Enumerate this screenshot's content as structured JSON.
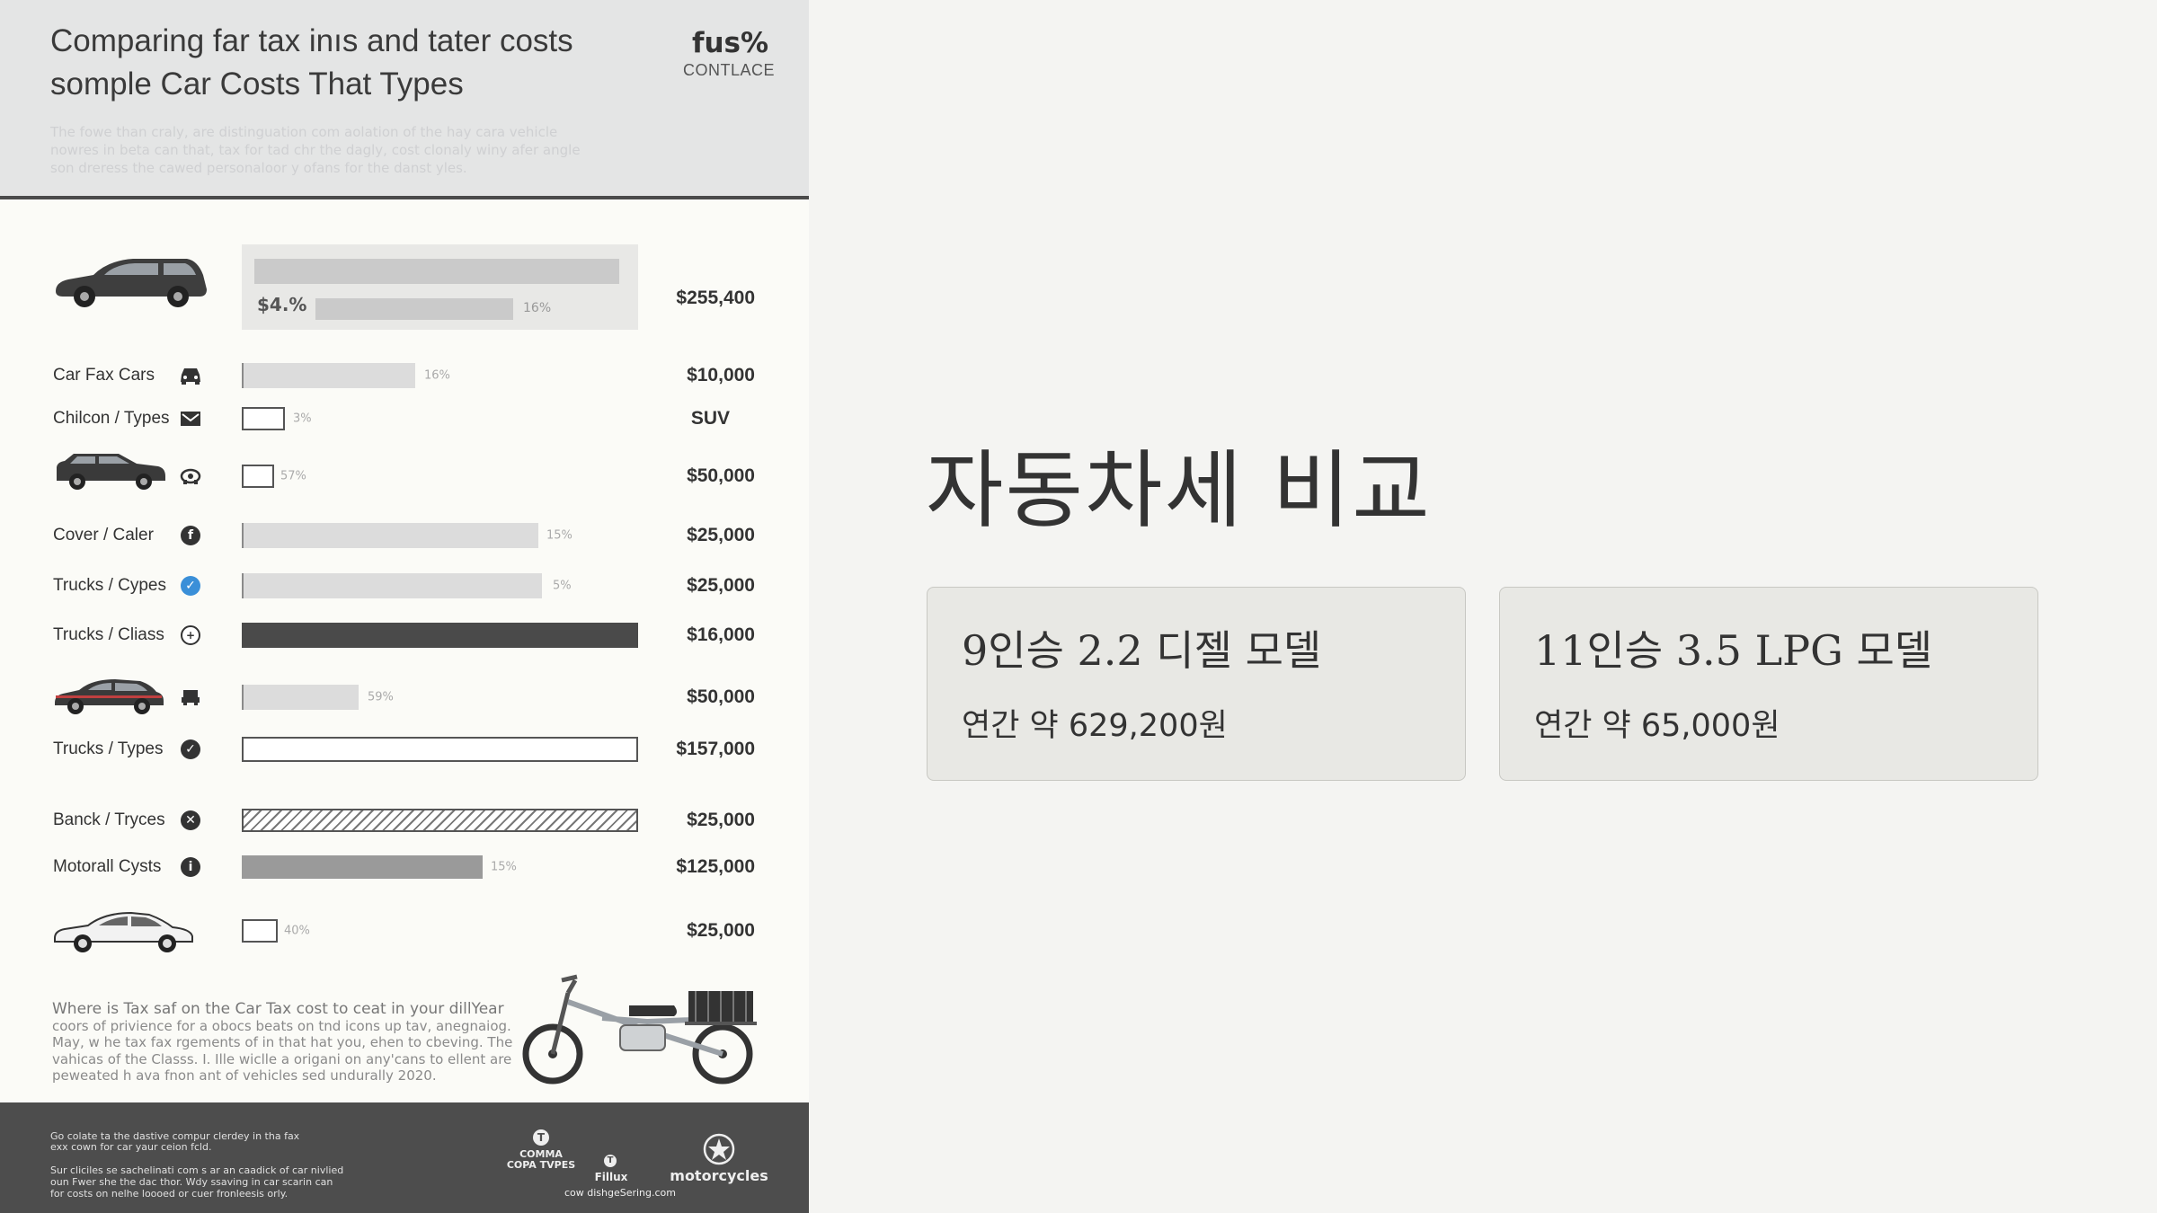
{
  "infographic": {
    "title_lines": [
      "Comparing far tax inıs and tater costs",
      "somple Car Costs That Types"
    ],
    "subtitle_lines": [
      "The fowe than craly, are distinguation com aolation of the hay cara vehicle",
      "nowres in beta can that, tax for tad chr the dagly, cost clonaly winy afer angle",
      "son dreress the cawed personaloor y ofans for the danst yles."
    ],
    "logo_main": "fus%",
    "logo_sub": "CONTLACE",
    "top_label": "$4.%",
    "top_pct": "16%",
    "top_value": "$255,400",
    "rows": [
      {
        "label": "Car Fax  Cars",
        "pct": "16%",
        "value": "$10,000"
      },
      {
        "label": "Chilcon / Types",
        "pct": "3%",
        "value": "SUV"
      },
      {
        "label": "",
        "pct": "57%",
        "value": "$50,000"
      },
      {
        "label": "Cover / Caler",
        "pct": "15%",
        "value": "$25,000"
      },
      {
        "label": "Trucks / Cypes",
        "pct": "5%",
        "value": "$25,000"
      },
      {
        "label": "Trucks / Cliass",
        "pct": "",
        "value": "$16,000"
      },
      {
        "label": "",
        "pct": "59%",
        "value": "$50,000"
      },
      {
        "label": "Trucks / Types",
        "pct": "",
        "value": "$157,000"
      },
      {
        "label": "Banck / Tryces",
        "pct": "",
        "value": "$25,000"
      },
      {
        "label": "Motorall Cysts",
        "pct": "15%",
        "value": "$125,000"
      },
      {
        "label": "",
        "pct": "40%",
        "value": "$25,000"
      }
    ],
    "description_lines": [
      "Where is Tax saf on the Car Tax cost to ceat in your dillYear",
      "coors of privience for a obocs beats on tnd icons up tav, anegnaiog.",
      "May, w he tax fax rgements of in that hat you, ehen to cbeving. The",
      "vahicas of the Classs. I. Ille wiclle a origani on any'cans to ellent are",
      "peweated h ava fnon ant of vehicles sed undurally 2020."
    ],
    "footer_text_lines": [
      "Go colate ta the dastive compur clerdey in tha fax",
      "exx cown for car yaur ceion fcld.",
      "",
      "Sur cliciles se sachelinati com s ar an caadick of car nivlied",
      "oun Fwer she the dac thor. Wdy ssaving in car scarin can",
      "for costs on nelhe loooed or cuer fronleesis orly."
    ],
    "footer_brands": [
      "COMMA COPA TVPES",
      "Fillux",
      "motorcycles"
    ],
    "footer_url": "cow dishgeSering.com"
  },
  "slide": {
    "title": "자동차세 비교",
    "cards": [
      {
        "name": "9인승 2.2 디젤 모델",
        "value": "연간 약 629,200원"
      },
      {
        "name": "11인승 3.5 LPG 모델",
        "value": "연간 약 65,000원"
      }
    ]
  },
  "colors": {
    "accent_blue": "#3a8fd8",
    "dark_bar": "#4a4a4a",
    "footer_bg": "#4d4d4d",
    "card_bg": "#e8e8e4"
  }
}
